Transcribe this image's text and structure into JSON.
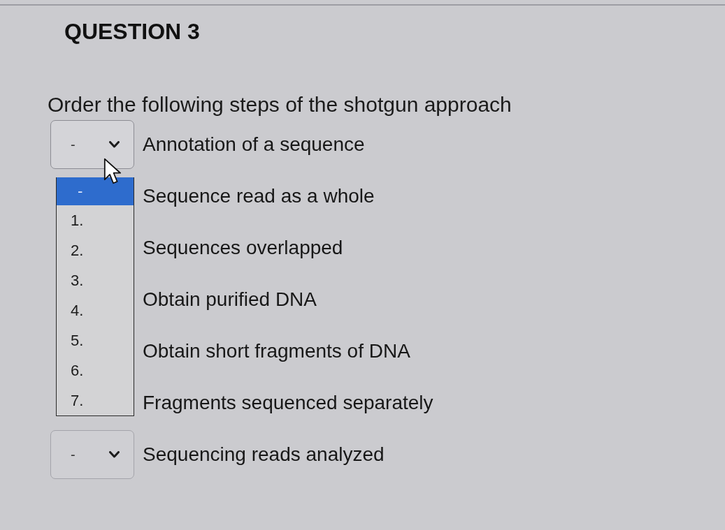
{
  "question": {
    "title": "QUESTION 3",
    "prompt": "Order the following steps of the shotgun approach"
  },
  "steps": [
    {
      "label": "Annotation of a sequence",
      "select": {
        "value": "-",
        "open": true,
        "options": [
          {
            "label": "-",
            "selected": true
          },
          {
            "label": "1.",
            "selected": false
          },
          {
            "label": "2.",
            "selected": false
          },
          {
            "label": "3.",
            "selected": false
          },
          {
            "label": "4.",
            "selected": false
          },
          {
            "label": "5.",
            "selected": false
          },
          {
            "label": "6.",
            "selected": false
          },
          {
            "label": "7.",
            "selected": false
          }
        ]
      }
    },
    {
      "label": "Sequence read as a whole"
    },
    {
      "label": "Sequences overlapped"
    },
    {
      "label": "Obtain purified DNA"
    },
    {
      "label": "Obtain short fragments of DNA"
    },
    {
      "label": "Fragments sequenced separately"
    },
    {
      "label": "Sequencing reads analyzed",
      "select": {
        "value": "-",
        "open": false
      }
    }
  ]
}
